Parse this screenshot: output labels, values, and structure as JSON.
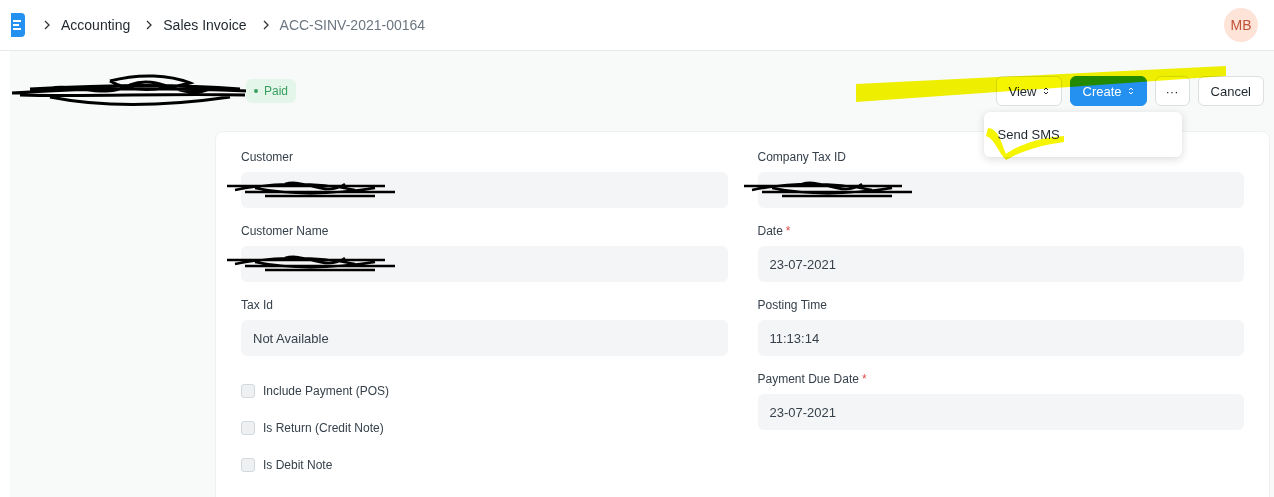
{
  "breadcrumbs": [
    "Accounting",
    "Sales Invoice",
    "ACC-SINV-2021-00164"
  ],
  "avatar": "MB",
  "title": {
    "redacted": true
  },
  "status": {
    "label": "Paid",
    "color": "#38a160"
  },
  "actions": [
    {
      "label": "View",
      "kind": "dropdown"
    },
    {
      "label": "Create",
      "kind": "primary-dropdown"
    },
    {
      "label": "···",
      "kind": "more"
    },
    {
      "label": "Cancel",
      "kind": "plain"
    }
  ],
  "menu": {
    "items": [
      "Send SMS"
    ]
  },
  "left_fields": [
    {
      "kind": "field",
      "label": "Customer",
      "redacted": true
    },
    {
      "kind": "field",
      "label": "Customer Name",
      "redacted": true
    },
    {
      "kind": "field",
      "label": "Tax Id",
      "value": "Not Available"
    },
    {
      "kind": "checkbox",
      "label": "Include Payment (POS)",
      "checked": false
    },
    {
      "kind": "checkbox",
      "label": "Is Return (Credit Note)",
      "checked": false
    },
    {
      "kind": "checkbox",
      "label": "Is Debit Note",
      "checked": false
    }
  ],
  "right_fields": [
    {
      "kind": "field",
      "label": "Company Tax ID",
      "redacted": true
    },
    {
      "kind": "field",
      "label": "Date",
      "required_mark": "*",
      "value": "23-07-2021"
    },
    {
      "kind": "field",
      "label": "Posting Time",
      "value": "11:13:14"
    },
    {
      "kind": "field",
      "label": "Payment Due Date",
      "required_mark": "*",
      "value": "23-07-2021"
    }
  ]
}
